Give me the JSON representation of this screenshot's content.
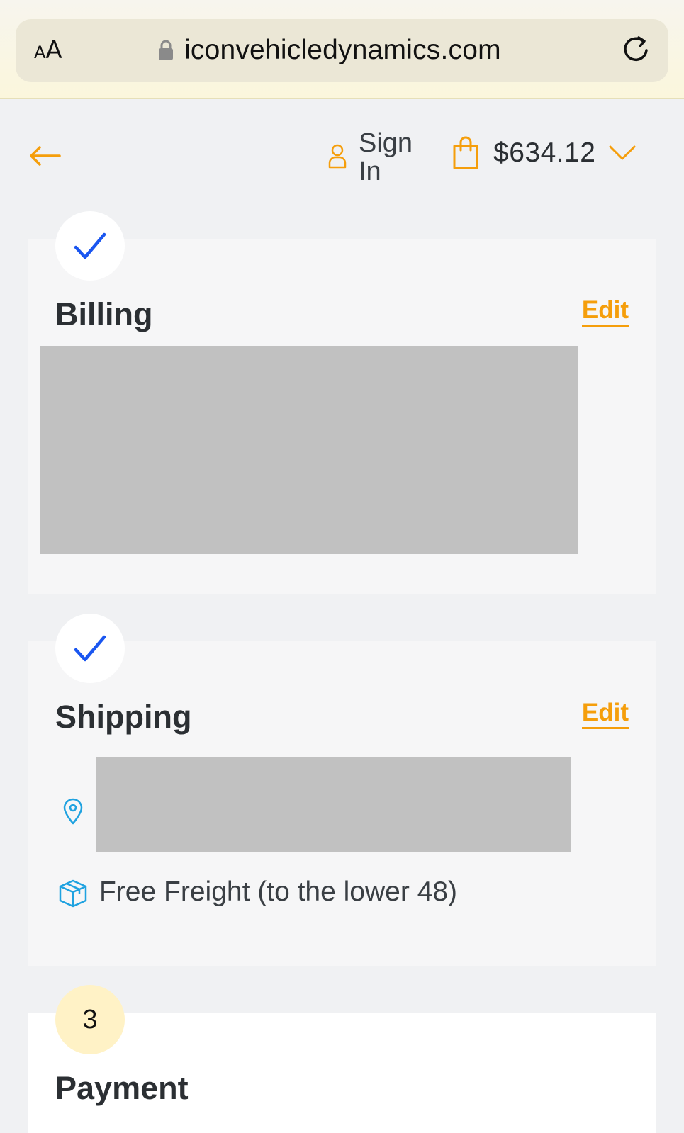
{
  "browser": {
    "text_size_label_small": "A",
    "text_size_label_big": "A",
    "url": "iconvehicledynamics.com"
  },
  "header": {
    "sign_in_label": "Sign In",
    "cart_total": "$634.12"
  },
  "steps": {
    "billing": {
      "title": "Billing",
      "edit_label": "Edit"
    },
    "shipping": {
      "title": "Shipping",
      "edit_label": "Edit",
      "method": "Free Freight (to the lower 48)"
    },
    "payment": {
      "number": "3",
      "title": "Payment"
    }
  },
  "colors": {
    "accent": "#f59e0b",
    "check": "#1a56f0",
    "icon_blue": "#1fa2e0",
    "redaction": "#c1c1c1"
  }
}
